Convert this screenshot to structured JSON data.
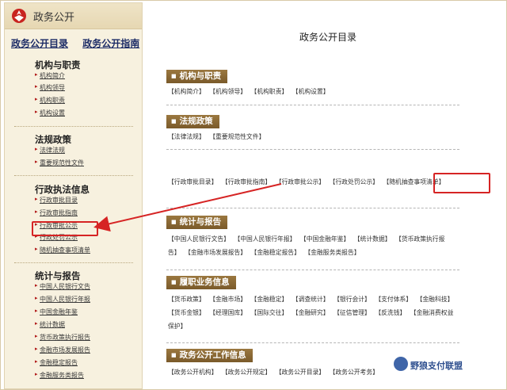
{
  "left": {
    "title": "政务公开",
    "links": [
      "政务公开目录",
      "政务公开指南"
    ],
    "sections": [
      {
        "title": "机构与职责",
        "items": [
          "机构简介",
          "机构领导",
          "机构职责",
          "机构设置"
        ]
      },
      {
        "title": "法规政策",
        "items": [
          "法律法规",
          "重要规范性文件"
        ]
      },
      {
        "title": "行政执法信息",
        "items": [
          "行政审批目录",
          "行政审批指南",
          "行政审批公示",
          "行政处罚公示",
          "随机抽查事项清单"
        ]
      },
      {
        "title": "统计与报告",
        "items": [
          "中国人民银行文告",
          "中国人民银行年报",
          "中国金融年鉴",
          "统计数据",
          "货币政策执行报告",
          "金融市场发展报告",
          "金融稳定报告",
          "金融服务类报告"
        ]
      }
    ]
  },
  "right": {
    "title": "政务公开目录",
    "sections": [
      {
        "title": "机构与职责",
        "items": [
          "【机构简介】",
          "【机构领导】",
          "【机构职责】",
          "【机构设置】"
        ]
      },
      {
        "title": "法规政策",
        "items": [
          "【法律法规】",
          "【重要规范性文件】"
        ]
      },
      {
        "title": "",
        "items": [
          "【行政审批目录】",
          "【行政审批指南】",
          "【行政审批公示】",
          "【行政处罚公示】",
          "【随机抽查事项清单】"
        ]
      },
      {
        "title": "统计与报告",
        "items": [
          "【中国人民银行文告】",
          "【中国人民银行年报】",
          "【中国金融年鉴】",
          "【统计数据】",
          "【货币政策执行报告】",
          "【金融市场发展报告】",
          "【金融稳定报告】",
          "【金融服务类报告】"
        ]
      },
      {
        "title": "履职业务信息",
        "items": [
          "【货币政策】",
          "【金融市场】",
          "【金融稳定】",
          "【调查统计】",
          "【银行会计】",
          "【支付体系】",
          "【金融科技】",
          "【货币金银】",
          "【经理国库】",
          "【国际交往】",
          "【金融研究】",
          "【征信管理】",
          "【反洗钱】",
          "【金融消费权益保护】"
        ]
      },
      {
        "title": "政务公开工作信息",
        "items": [
          "【政务公开机构】",
          "【政务公开规定】",
          "【政务公开目录】",
          "【政务公开考务】"
        ]
      }
    ]
  },
  "watermark": "野狼支付联盟",
  "colors": {
    "accent_red": "#d62424",
    "bar_brown": "#8a6a35",
    "link_blue": "#1c2c66"
  }
}
